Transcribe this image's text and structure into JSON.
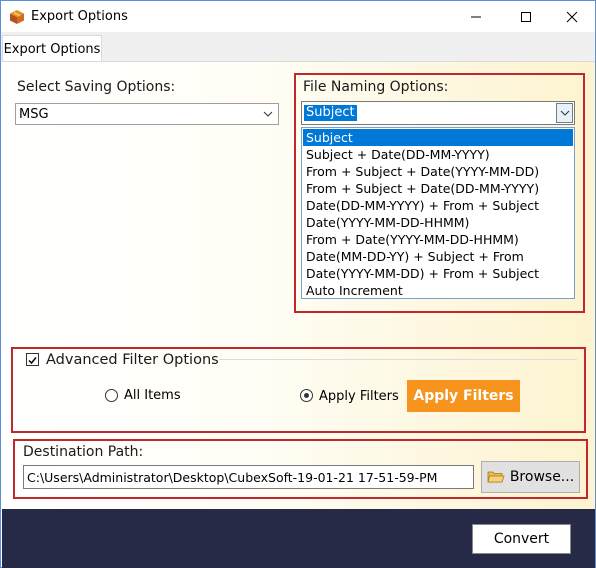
{
  "window": {
    "title": "Export Options",
    "icon": "app-box-icon"
  },
  "tabs": [
    {
      "label": "Export Options",
      "active": true
    }
  ],
  "saving": {
    "label": "Select Saving Options:",
    "value": "MSG"
  },
  "naming": {
    "label": "File Naming Options:",
    "value": "Subject",
    "options": [
      "Subject",
      "Subject + Date(DD-MM-YYYY)",
      "From + Subject + Date(YYYY-MM-DD)",
      "From + Subject + Date(DD-MM-YYYY)",
      "Date(DD-MM-YYYY) + From + Subject",
      "Date(YYYY-MM-DD-HHMM)",
      "From + Date(YYYY-MM-DD-HHMM)",
      "Date(MM-DD-YY) + Subject + From",
      "Date(YYYY-MM-DD) + From + Subject",
      "Auto Increment"
    ]
  },
  "filter": {
    "label": "Advanced Filter Options",
    "checked": true,
    "all_items_label": "All Items",
    "apply_filters_radio_label": "Apply Filters",
    "selected": "Apply Filters",
    "apply_button": "Apply Filters"
  },
  "destination": {
    "label": "Destination Path:",
    "value": "C:\\Users\\Administrator\\Desktop\\CubexSoft-19-01-21 17-51-59-PM",
    "browse_label": "Browse..."
  },
  "footer": {
    "convert_label": "Convert"
  },
  "colors": {
    "accent": "#f7941d",
    "highlight": "#c0282d",
    "footer_bg": "#262a46",
    "selection": "#0078d7"
  }
}
